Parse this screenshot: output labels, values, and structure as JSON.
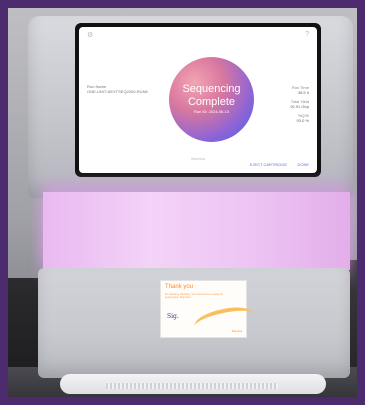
{
  "screen": {
    "headline_line1": "Sequencing",
    "headline_line2": "Complete",
    "subline": "Run ID: 2024-06-13",
    "run_name_label": "Run Name",
    "run_name_value": "ONE-UNIT-NEXTSEQ2000-RUN6",
    "stats": [
      {
        "label": "Run Time",
        "value": "38.5 h"
      },
      {
        "label": "Total Yield",
        "value": "92.91 Gbp"
      },
      {
        "label": "%Q30",
        "value": "93.0 %"
      }
    ],
    "brand": "illumina",
    "eject_label": "EJECT CARTRIDGE",
    "done_label": "DONE",
    "icons": [
      "settings-icon",
      "help-icon"
    ]
  },
  "sticker": {
    "title": "Thank you",
    "text": "for choosing NextSeq. Your instrument is ready for sequencing. Sign here.",
    "signature": "Sig.",
    "brand": "illumina"
  },
  "colors": {
    "accent_glow": "#f0c4f5",
    "screen_button": "#6a6de6",
    "border": "#4b2a6e"
  }
}
